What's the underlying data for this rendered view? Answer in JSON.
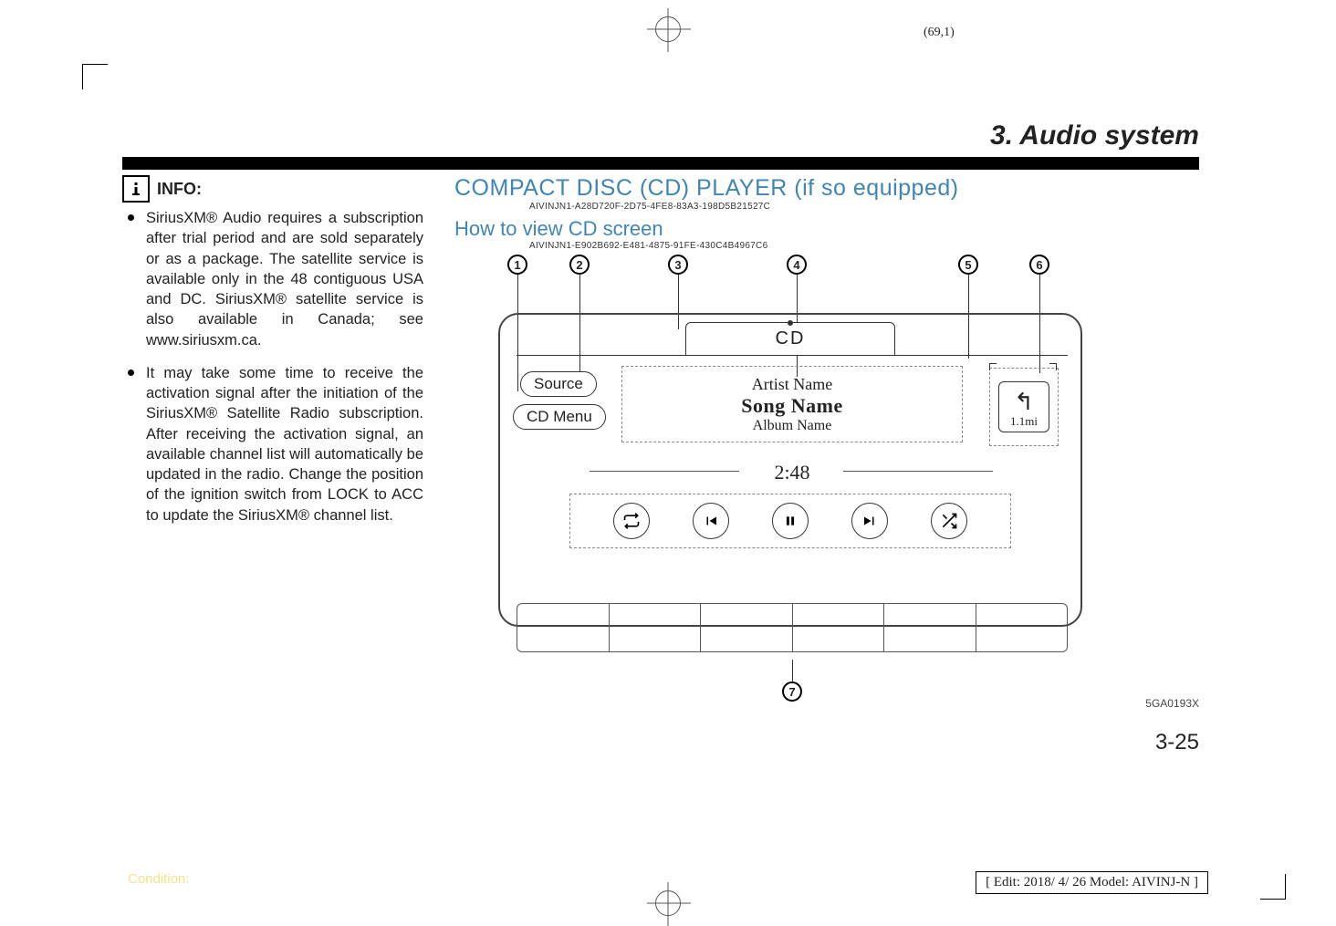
{
  "page_coord": "(69,1)",
  "chapter_title": "3. Audio system",
  "info_label": "INFO:",
  "bullets": [
    "SiriusXM® Audio requires a subscription after trial period and are sold separately or as a package. The satellite service is available only in the 48 contiguous USA and DC. SiriusXM® satellite service is also available in Canada; see www.siriusxm.ca.",
    "It may take some time to receive the activation signal after the initiation of the SiriusXM® Satellite Radio subscription. After receiving the activation signal, an available channel list will automatically be updated in the radio. Change the position of the ignition switch from LOCK to ACC to update the SiriusXM® channel list."
  ],
  "heading_main": "COMPACT DISC (CD) PLAYER (if so equipped)",
  "code_main": "AIVINJN1-A28D720F-2D75-4FE8-83A3-198D5B21527C",
  "heading_sub": "How to view CD screen",
  "code_sub": "AIVINJN1-E902B692-E481-4875-91FE-430C4B4967C6",
  "callouts": {
    "c1": "1",
    "c2": "2",
    "c3": "3",
    "c4": "4",
    "c5": "5",
    "c6": "6",
    "c7": "7"
  },
  "cd": {
    "tab_label": "CD",
    "source_btn": "Source",
    "cdmenu_btn": "CD Menu",
    "artist": "Artist Name",
    "song": "Song Name",
    "album": "Album Name",
    "time": "2:48",
    "nav_dist": "1.1mi"
  },
  "image_code": "5GA0193X",
  "page_num": "3-25",
  "condition_label": "Condition:",
  "edit_info": "[ Edit: 2018/ 4/ 26   Model: AIVINJ-N ]"
}
